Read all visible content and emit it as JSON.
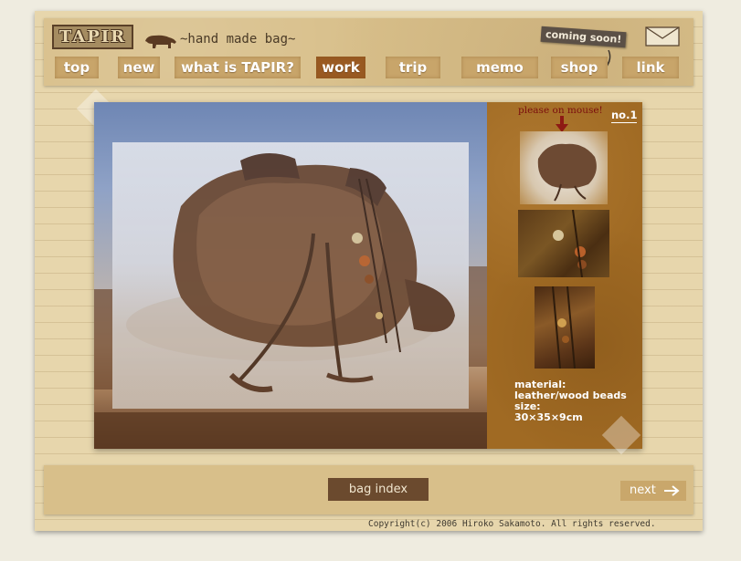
{
  "header": {
    "logo_text": "TAPIR",
    "tagline": "~hand made bag~",
    "coming_soon": "coming soon!"
  },
  "nav": {
    "items": [
      {
        "label": "top"
      },
      {
        "label": "new"
      },
      {
        "label": "what is TAPIR?"
      },
      {
        "label": "work",
        "active": true
      },
      {
        "label": "trip"
      },
      {
        "label": "memo"
      },
      {
        "label": "shop"
      },
      {
        "label": "link"
      }
    ]
  },
  "panel": {
    "hint": "please on mouse!",
    "number": "no.1",
    "material_label": "material:",
    "material_value": "leather/wood beads",
    "size_label": "size:",
    "size_value": "30×35×9cm"
  },
  "footer": {
    "bag_index": "bag index",
    "next": "next",
    "copyright": "Copyright(c) 2006 Hiroko Sakamoto. All rights reserved."
  },
  "colors": {
    "active_nav": "#9a5a22",
    "panel_bg": "#a06a23",
    "hint_red": "#7b0e0e"
  }
}
